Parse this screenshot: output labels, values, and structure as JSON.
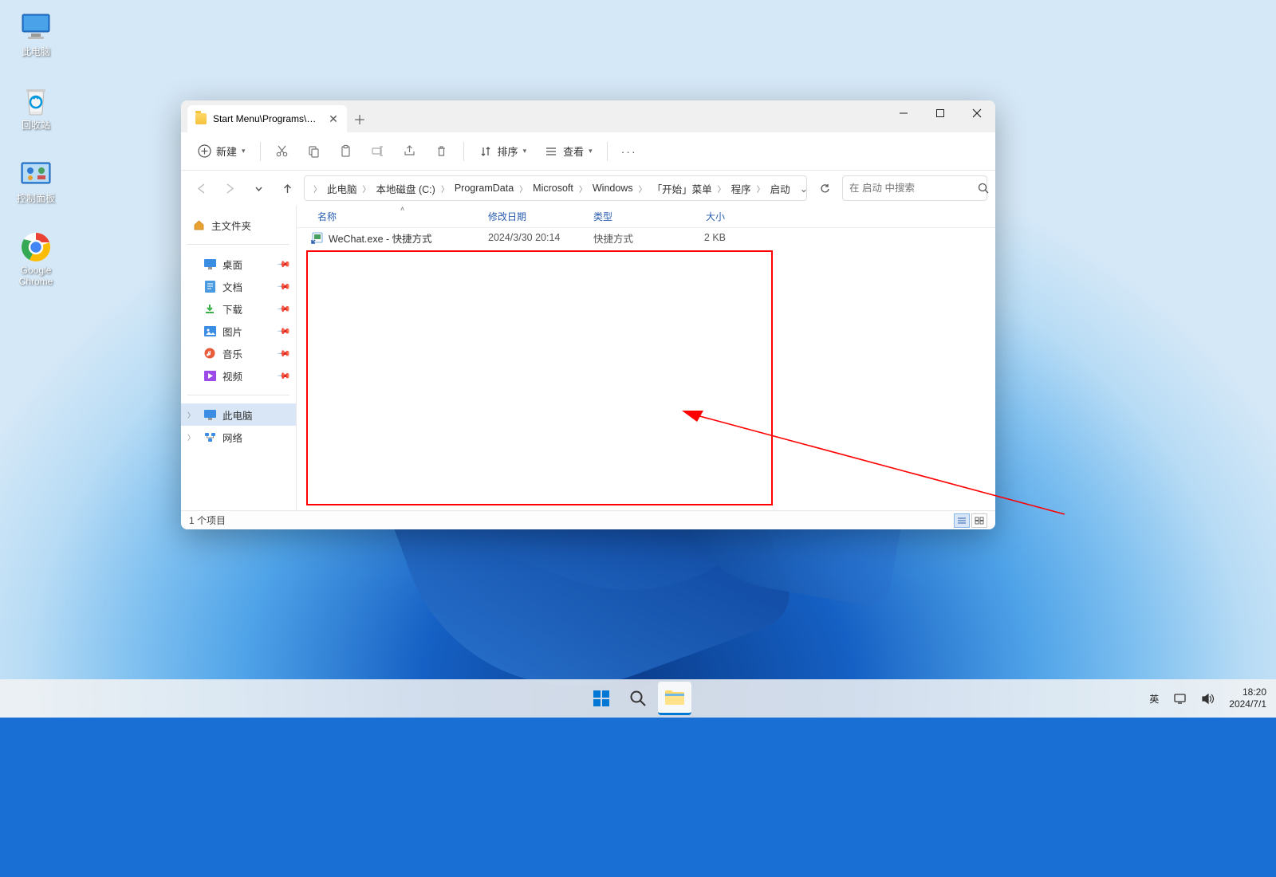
{
  "desktop": {
    "icons": [
      {
        "name": "this-pc",
        "label": "此电脑"
      },
      {
        "name": "recycle-bin",
        "label": "回收站"
      },
      {
        "name": "control-panel",
        "label": "控制面板"
      },
      {
        "name": "google-chrome",
        "label": "Google Chrome"
      }
    ]
  },
  "explorer": {
    "tab_title": "Start Menu\\Programs\\Startup",
    "toolbar": {
      "new": "新建",
      "sort": "排序",
      "view": "查看"
    },
    "breadcrumbs": [
      "此电脑",
      "本地磁盘 (C:)",
      "ProgramData",
      "Microsoft",
      "Windows",
      "「开始」菜单",
      "程序",
      "启动"
    ],
    "search_placeholder": "在 启动 中搜索",
    "sidebar": {
      "home": "主文件夹",
      "quick": [
        {
          "label": "桌面"
        },
        {
          "label": "文档"
        },
        {
          "label": "下载"
        },
        {
          "label": "图片"
        },
        {
          "label": "音乐"
        },
        {
          "label": "视频"
        }
      ],
      "this_pc": "此电脑",
      "network": "网络"
    },
    "columns": {
      "name": "名称",
      "date": "修改日期",
      "type": "类型",
      "size": "大小"
    },
    "rows": [
      {
        "name": "WeChat.exe - 快捷方式",
        "date": "2024/3/30 20:14",
        "type": "快捷方式",
        "size": "2 KB"
      }
    ],
    "status": "1 个项目"
  },
  "taskbar": {
    "ime": "英",
    "time": "18:20",
    "date": "2024/7/1"
  }
}
